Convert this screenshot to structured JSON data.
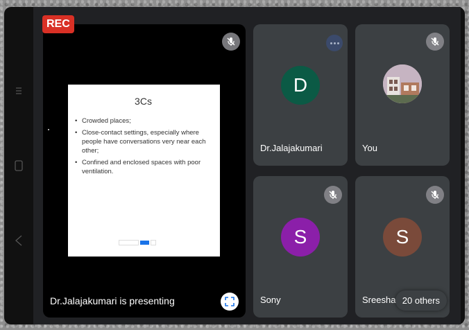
{
  "rec_label": "REC",
  "presentation": {
    "presenter_label": "Dr.Jalajakumari is presenting",
    "slide": {
      "title": "3Cs",
      "bullets": [
        "Crowded places;",
        "Close-contact settings, especially where people have conversations very near each other;",
        "Confined and enclosed spaces with poor ventilation."
      ]
    }
  },
  "participants": [
    {
      "name": "Dr.Jalajakumari",
      "initial": "D",
      "color": "#0b5a45"
    },
    {
      "name": "You",
      "initial": "",
      "color": ""
    },
    {
      "name": "Sony",
      "initial": "S",
      "color": "#8b1fa9"
    },
    {
      "name": "Sreesha",
      "initial": "S",
      "color": "#7a4a3a"
    }
  ],
  "others_label": "20 others",
  "icons": {
    "mute": "mic-off-icon",
    "fullscreen": "fullscreen-icon",
    "more": "more-options-icon"
  }
}
